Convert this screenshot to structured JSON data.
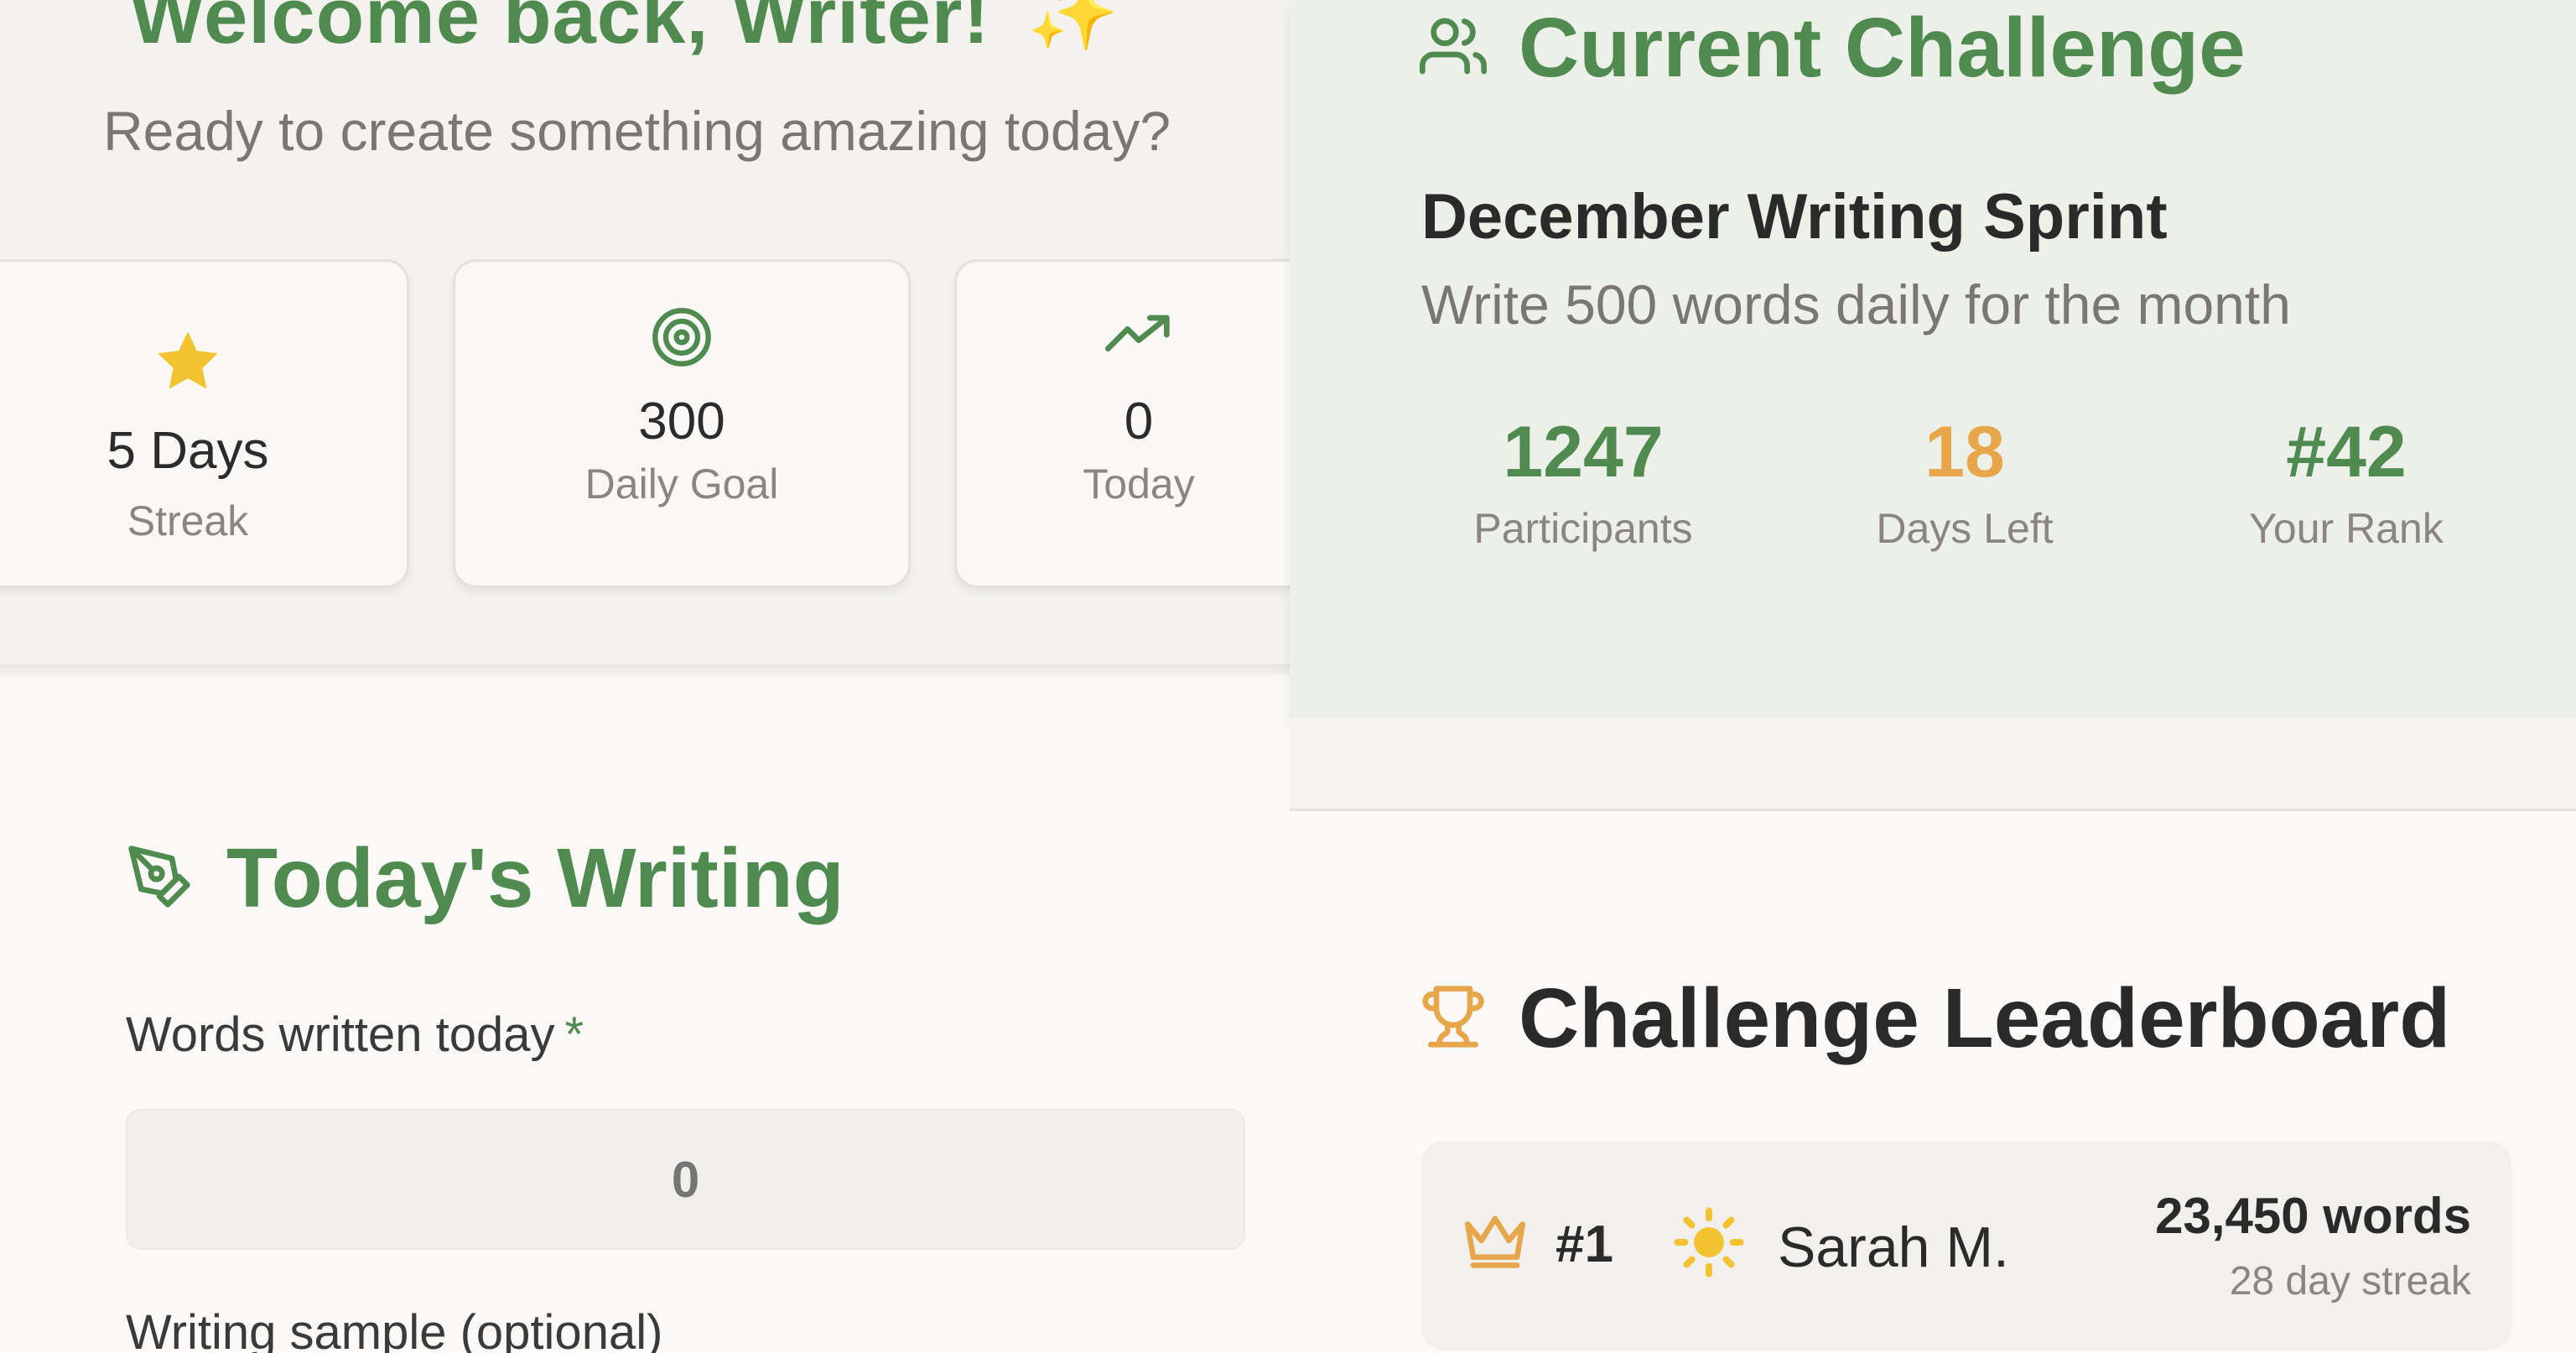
{
  "welcome": {
    "title": "Welcome back, Writer!",
    "sparkle": "✨",
    "subtitle": "Ready to create something amazing today?"
  },
  "stats": [
    {
      "icon": "star-icon",
      "value": "5 Days",
      "label": "Streak"
    },
    {
      "icon": "target-icon",
      "value": "300",
      "label": "Daily Goal"
    },
    {
      "icon": "trending-up-icon",
      "value": "0",
      "label": "Today"
    }
  ],
  "writing": {
    "title": "Today's Writing",
    "words_label": "Words written today",
    "required_mark": "*",
    "words_placeholder": "0",
    "sample_label": "Writing sample (optional)"
  },
  "challenge": {
    "title": "Current Challenge",
    "name": "December Writing Sprint",
    "description": "Write 500 words daily for the month",
    "stats": [
      {
        "value": "1247",
        "label": "Participants",
        "color": "#4f8a4f"
      },
      {
        "value": "18",
        "label": "Days Left",
        "color": "#e8a64a"
      },
      {
        "value": "#42",
        "label": "Your Rank",
        "color": "#4f8a4f"
      }
    ]
  },
  "leaderboard": {
    "title": "Challenge Leaderboard",
    "rows": [
      {
        "rank": "#1",
        "avatar": "sun-icon",
        "name": "Sarah M.",
        "words": "23,450 words",
        "streak": "28 day streak"
      }
    ]
  },
  "colors": {
    "accent": "#4f8a4f",
    "gold": "#e8a64a",
    "star": "#f2c230"
  }
}
